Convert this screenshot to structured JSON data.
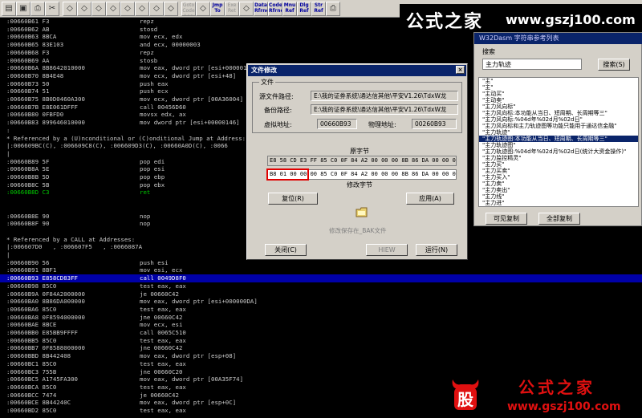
{
  "toolbar": {
    "buttons": [
      {
        "label": "",
        "icon": "folder-icon"
      },
      {
        "label": "",
        "icon": "save-icon"
      },
      {
        "label": "",
        "icon": "print-icon"
      },
      {
        "label": "",
        "icon": "cut-icon"
      },
      {
        "label": "",
        "icon": "tool-icon"
      },
      {
        "label": "",
        "icon": "tool-icon"
      },
      {
        "label": "",
        "icon": "tool-icon"
      },
      {
        "label": "",
        "icon": "tool-icon"
      },
      {
        "label": "",
        "icon": "tool-icon"
      },
      {
        "label": "",
        "icon": "tool-icon"
      },
      {
        "label": "",
        "icon": "tool-icon"
      },
      {
        "label": "",
        "icon": "tool-icon"
      },
      {
        "label": "Goto Code Loc",
        "icon": ""
      },
      {
        "label": "",
        "icon": "tool-icon"
      },
      {
        "label": "Jmp To",
        "icon": ""
      },
      {
        "label": "Exe Ret",
        "icon": ""
      },
      {
        "label": "",
        "icon": "tool-icon"
      },
      {
        "label": "Data Rfrnc",
        "icon": ""
      },
      {
        "label": "Code Rfrnc",
        "icon": ""
      },
      {
        "label": "Mnu Ref",
        "icon": ""
      },
      {
        "label": "Dlg Ref",
        "icon": ""
      },
      {
        "label": "Str Ref",
        "icon": ""
      },
      {
        "label": "",
        "icon": "print-icon"
      }
    ]
  },
  "listing": [
    {
      "addr": ":00660B61 F3",
      "asm": "repz"
    },
    {
      "addr": ":00660B62 AB",
      "asm": "stosd"
    },
    {
      "addr": ":00660B63 8BCA",
      "asm": "mov ecx, edx"
    },
    {
      "addr": ":00660B65 83E103",
      "asm": "and ecx, 00000003"
    },
    {
      "addr": ":00660B68 F3",
      "asm": "repz"
    },
    {
      "addr": ":00660B69 AA",
      "asm": "stosb"
    },
    {
      "addr": ":00660B6A 8B8642010000",
      "asm": "mov eax, dword ptr [esi+00000142]"
    },
    {
      "addr": ":00660B70 8B4E48",
      "asm": "mov ecx, dword ptr [esi+48]"
    },
    {
      "addr": ":00660B73 50",
      "asm": "push eax"
    },
    {
      "addr": ":00660B74 51",
      "asm": "push ecx"
    },
    {
      "addr": ":00660B75 8B0D0460A300",
      "asm": "mov ecx, dword ptr [00A36004]"
    },
    {
      "addr": ":00660B7B E8E061DFFF",
      "asm": "call 00456D60"
    },
    {
      "addr": ":00660B80 0FBFD0",
      "asm": "movsx edx, ax"
    },
    {
      "addr": ":00660B83 899646010000",
      "asm": "mov dword ptr [esi+00000146]"
    },
    {
      "addr": ":",
      "asm": ""
    },
    {
      "addr": "* Referenced by a (U)nconditional or (C)onditional Jump at Address:",
      "asm": ""
    },
    {
      "addr": "|:006609BC(C), :006609C8(C), :006609D3(C), :00660A0D(C), :0066",
      "asm": ""
    },
    {
      "addr": "|",
      "asm": ""
    },
    {
      "addr": ":00660B89 5F",
      "asm": "pop edi"
    },
    {
      "addr": ":00660B8A 5E",
      "asm": "pop esi"
    },
    {
      "addr": ":00660B8B 5D",
      "asm": "pop ebp"
    },
    {
      "addr": ":00660B8C 5B",
      "asm": "pop ebx"
    },
    {
      "addr": ":00660B8D C3",
      "asm": "ret"
    },
    {
      "addr": "",
      "asm": ""
    },
    {
      "addr": "",
      "asm": ""
    },
    {
      "addr": ":00660B8E 90",
      "asm": "nop"
    },
    {
      "addr": ":00660B8F 90",
      "asm": "nop"
    },
    {
      "addr": "",
      "asm": ""
    },
    {
      "addr": "* Referenced by a CALL at Addresses:",
      "asm": ""
    },
    {
      "addr": "|:006607D0   , :006607F5   , :0066087A",
      "asm": ""
    },
    {
      "addr": "|",
      "asm": ""
    },
    {
      "addr": ":00660B90 56",
      "asm": "push esi"
    },
    {
      "addr": ":00660B91 8BF1",
      "asm": "mov esi, ecx"
    },
    {
      "addr": ":00660B93 E858CD83FF",
      "asm": "call 0049D8F0"
    },
    {
      "addr": ":00660B98 85C0",
      "asm": "test eax, eax"
    },
    {
      "addr": ":00660B9A 0F84A2000000",
      "asm": "je 00660C42"
    },
    {
      "addr": ":00660BA0 8B86DA000000",
      "asm": "mov eax, dword ptr [esi+000000DA]"
    },
    {
      "addr": ":00660BA6 85C0",
      "asm": "test eax, eax"
    },
    {
      "addr": ":00660BA8 0F8594000000",
      "asm": "jne 00660C42"
    },
    {
      "addr": ":00660BAE 8BCE",
      "asm": "mov ecx, esi"
    },
    {
      "addr": ":00660BB0 E85BB9FFFF",
      "asm": "call 0065C510"
    },
    {
      "addr": ":00660BB5 85C0",
      "asm": "test eax, eax"
    },
    {
      "addr": ":00660BB7 0F8588000000",
      "asm": "jne 00660C42"
    },
    {
      "addr": ":00660BBD 8B442408",
      "asm": "mov eax, dword ptr [esp+08]"
    },
    {
      "addr": ":00660BC1 85C0",
      "asm": "test eax, eax"
    },
    {
      "addr": ":00660BC3 755B",
      "asm": "jne 00660C20"
    },
    {
      "addr": ":00660BC5 A1745FA300",
      "asm": "mov eax, dword ptr [00A35F74]"
    },
    {
      "addr": ":00660BCA 85C0",
      "asm": "test eax, eax"
    },
    {
      "addr": ":00660BCC 7474",
      "asm": "je 00660C42"
    },
    {
      "addr": ":00660BCE 8B44240C",
      "asm": "mov eax, dword ptr [esp+0C]"
    },
    {
      "addr": ":00660BD2 85C0",
      "asm": "test eax, eax"
    }
  ],
  "watermark_top": {
    "brand": "公式之家",
    "url": "www.gszj100.com"
  },
  "watermark_bottom": {
    "logo_char": "股",
    "brand": "公式之家",
    "url": "www.gszj100.com"
  },
  "string_window": {
    "title": "W32Dasm 字符串参考列表",
    "search_label": "搜索",
    "search_value": "主力轨迹",
    "search_button": "搜索(S)",
    "items": [
      "\"主\"",
      "\"主\"",
      "\"主动买\"",
      "\"主动卖\"",
      "\"主力风向标\"",
      "\"主力风向标:本功能从当日、短周期、长周期等三\"",
      "\"主力风向标:%04d年%02d月%02d日\"",
      "\"主力风向标和主力轨迹图等功能只能用于通达信金融\"",
      "\"主力轨迹\"",
      "\"主力轨迹图:本功能从当日、短周期、长周期等三\"",
      "\"主力轨迹图\"",
      "\"主力轨迹图:%04d年%02d月%02d日(统计大资金操作)\"",
      "\"主力监控精灵\"",
      "\"主力买\"",
      "\"主力买卖\"",
      "\"主力买入\"",
      "\"主力卖\"",
      "\"主力卖出\"",
      "\"主力线\"",
      "\"主力进\""
    ],
    "selected_index": 9,
    "copy_button": "可见复制",
    "copy_all_button": "全部复制"
  },
  "dialog": {
    "title": "文件修改",
    "close_glyph": "×",
    "group_label": "文件",
    "src_label": "源文件路径:",
    "src_value": "E:\\我的证券系统\\通达信其他\\平安V1.26\\TdxW龙",
    "bak_label": "备份路径:",
    "bak_value": "E:\\我的证券系统\\通达信其他\\平安V1.26\\TdxW龙",
    "vaddr_label": "虚拟地址:",
    "vaddr_value": "00660B93",
    "paddr_label": "物理地址:",
    "paddr_value": "00260B93",
    "orig_label": "原字节",
    "orig_bytes": "E8 58 CD E3 FF 85 C0 0F 84 A2 00 00 00 8B 86 DA 00 00 00 85",
    "mod_bytes": "B8 01 00 00 00 85 C0 0F 84 A2 00 00 00 8B 86 DA 00 00 00 85",
    "mod_label": "修改字节",
    "restore_button": "复位(R)",
    "apply_button": "应用(A)",
    "disabled_text": "修改保存在_BAK文件",
    "close_button": "关闭(C)",
    "hiew_button": "HIEW",
    "run_button": "运行(N)"
  },
  "colors": {
    "selected_row": "#0000a8",
    "highlight_box": "#e00000",
    "caption": "#0a246a"
  }
}
